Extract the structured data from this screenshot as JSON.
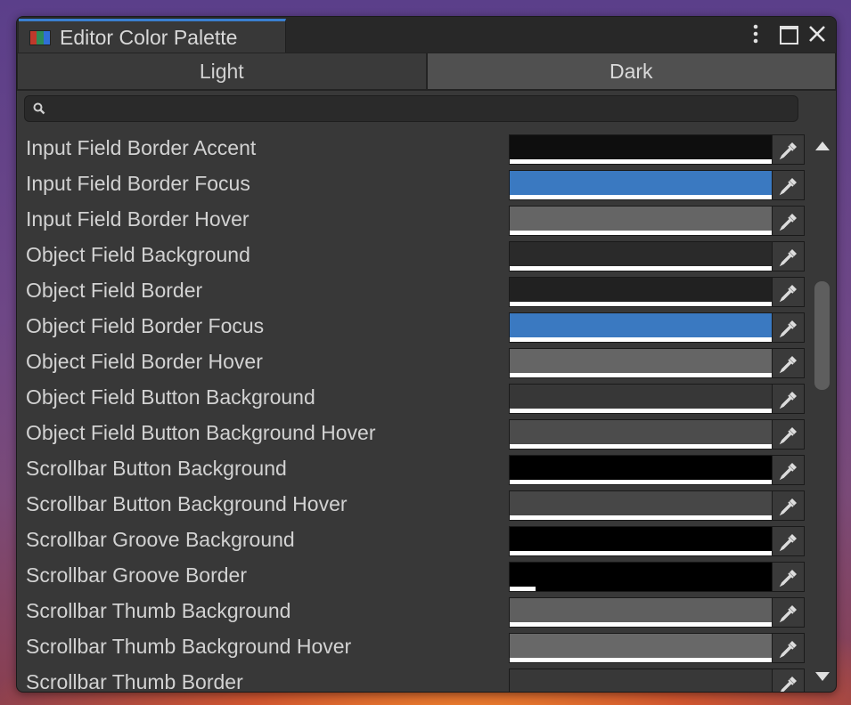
{
  "window": {
    "title": "Editor Color Palette",
    "icon": "color-palette-icon",
    "controls": [
      "kebab-menu-icon",
      "maximize-icon",
      "close-icon"
    ]
  },
  "mode_toggle": {
    "light_label": "Light",
    "dark_label": "Dark",
    "selected": "Dark"
  },
  "search": {
    "value": "",
    "placeholder": "",
    "icon": "search-icon"
  },
  "colors": {
    "accent": "#3a7fd0",
    "window_bg": "#383838"
  },
  "rows": [
    {
      "label": "Input Field Border Accent",
      "color": "#0e0e0e",
      "alpha": 1.0
    },
    {
      "label": "Input Field Border Focus",
      "color": "#3a79c1",
      "alpha": 1.0
    },
    {
      "label": "Input Field Border Hover",
      "color": "#656565",
      "alpha": 1.0
    },
    {
      "label": "Object Field Background",
      "color": "#2a2a2a",
      "alpha": 1.0
    },
    {
      "label": "Object Field Border",
      "color": "#212121",
      "alpha": 1.0
    },
    {
      "label": "Object Field Border Focus",
      "color": "#3a79c1",
      "alpha": 1.0
    },
    {
      "label": "Object Field Border Hover",
      "color": "#656565",
      "alpha": 1.0
    },
    {
      "label": "Object Field Button Background",
      "color": "#373737",
      "alpha": 1.0
    },
    {
      "label": "Object Field Button Background Hover",
      "color": "#4c4c4c",
      "alpha": 1.0
    },
    {
      "label": "Scrollbar Button Background",
      "color": "#000000",
      "alpha": 1.0
    },
    {
      "label": "Scrollbar Button Background Hover",
      "color": "#474747",
      "alpha": 1.0
    },
    {
      "label": "Scrollbar Groove Background",
      "color": "#000000",
      "alpha": 1.0
    },
    {
      "label": "Scrollbar Groove Border",
      "color": "#000000",
      "alpha": 0.1
    },
    {
      "label": "Scrollbar Thumb Background",
      "color": "#5f5f5f",
      "alpha": 1.0
    },
    {
      "label": "Scrollbar Thumb Background Hover",
      "color": "#686868",
      "alpha": 1.0
    },
    {
      "label": "Scrollbar Thumb Border",
      "color": "#383838",
      "alpha": 1.0
    }
  ],
  "eyedropper_icon": "eyedropper-icon",
  "scrollbar": {
    "position": 0.55
  }
}
